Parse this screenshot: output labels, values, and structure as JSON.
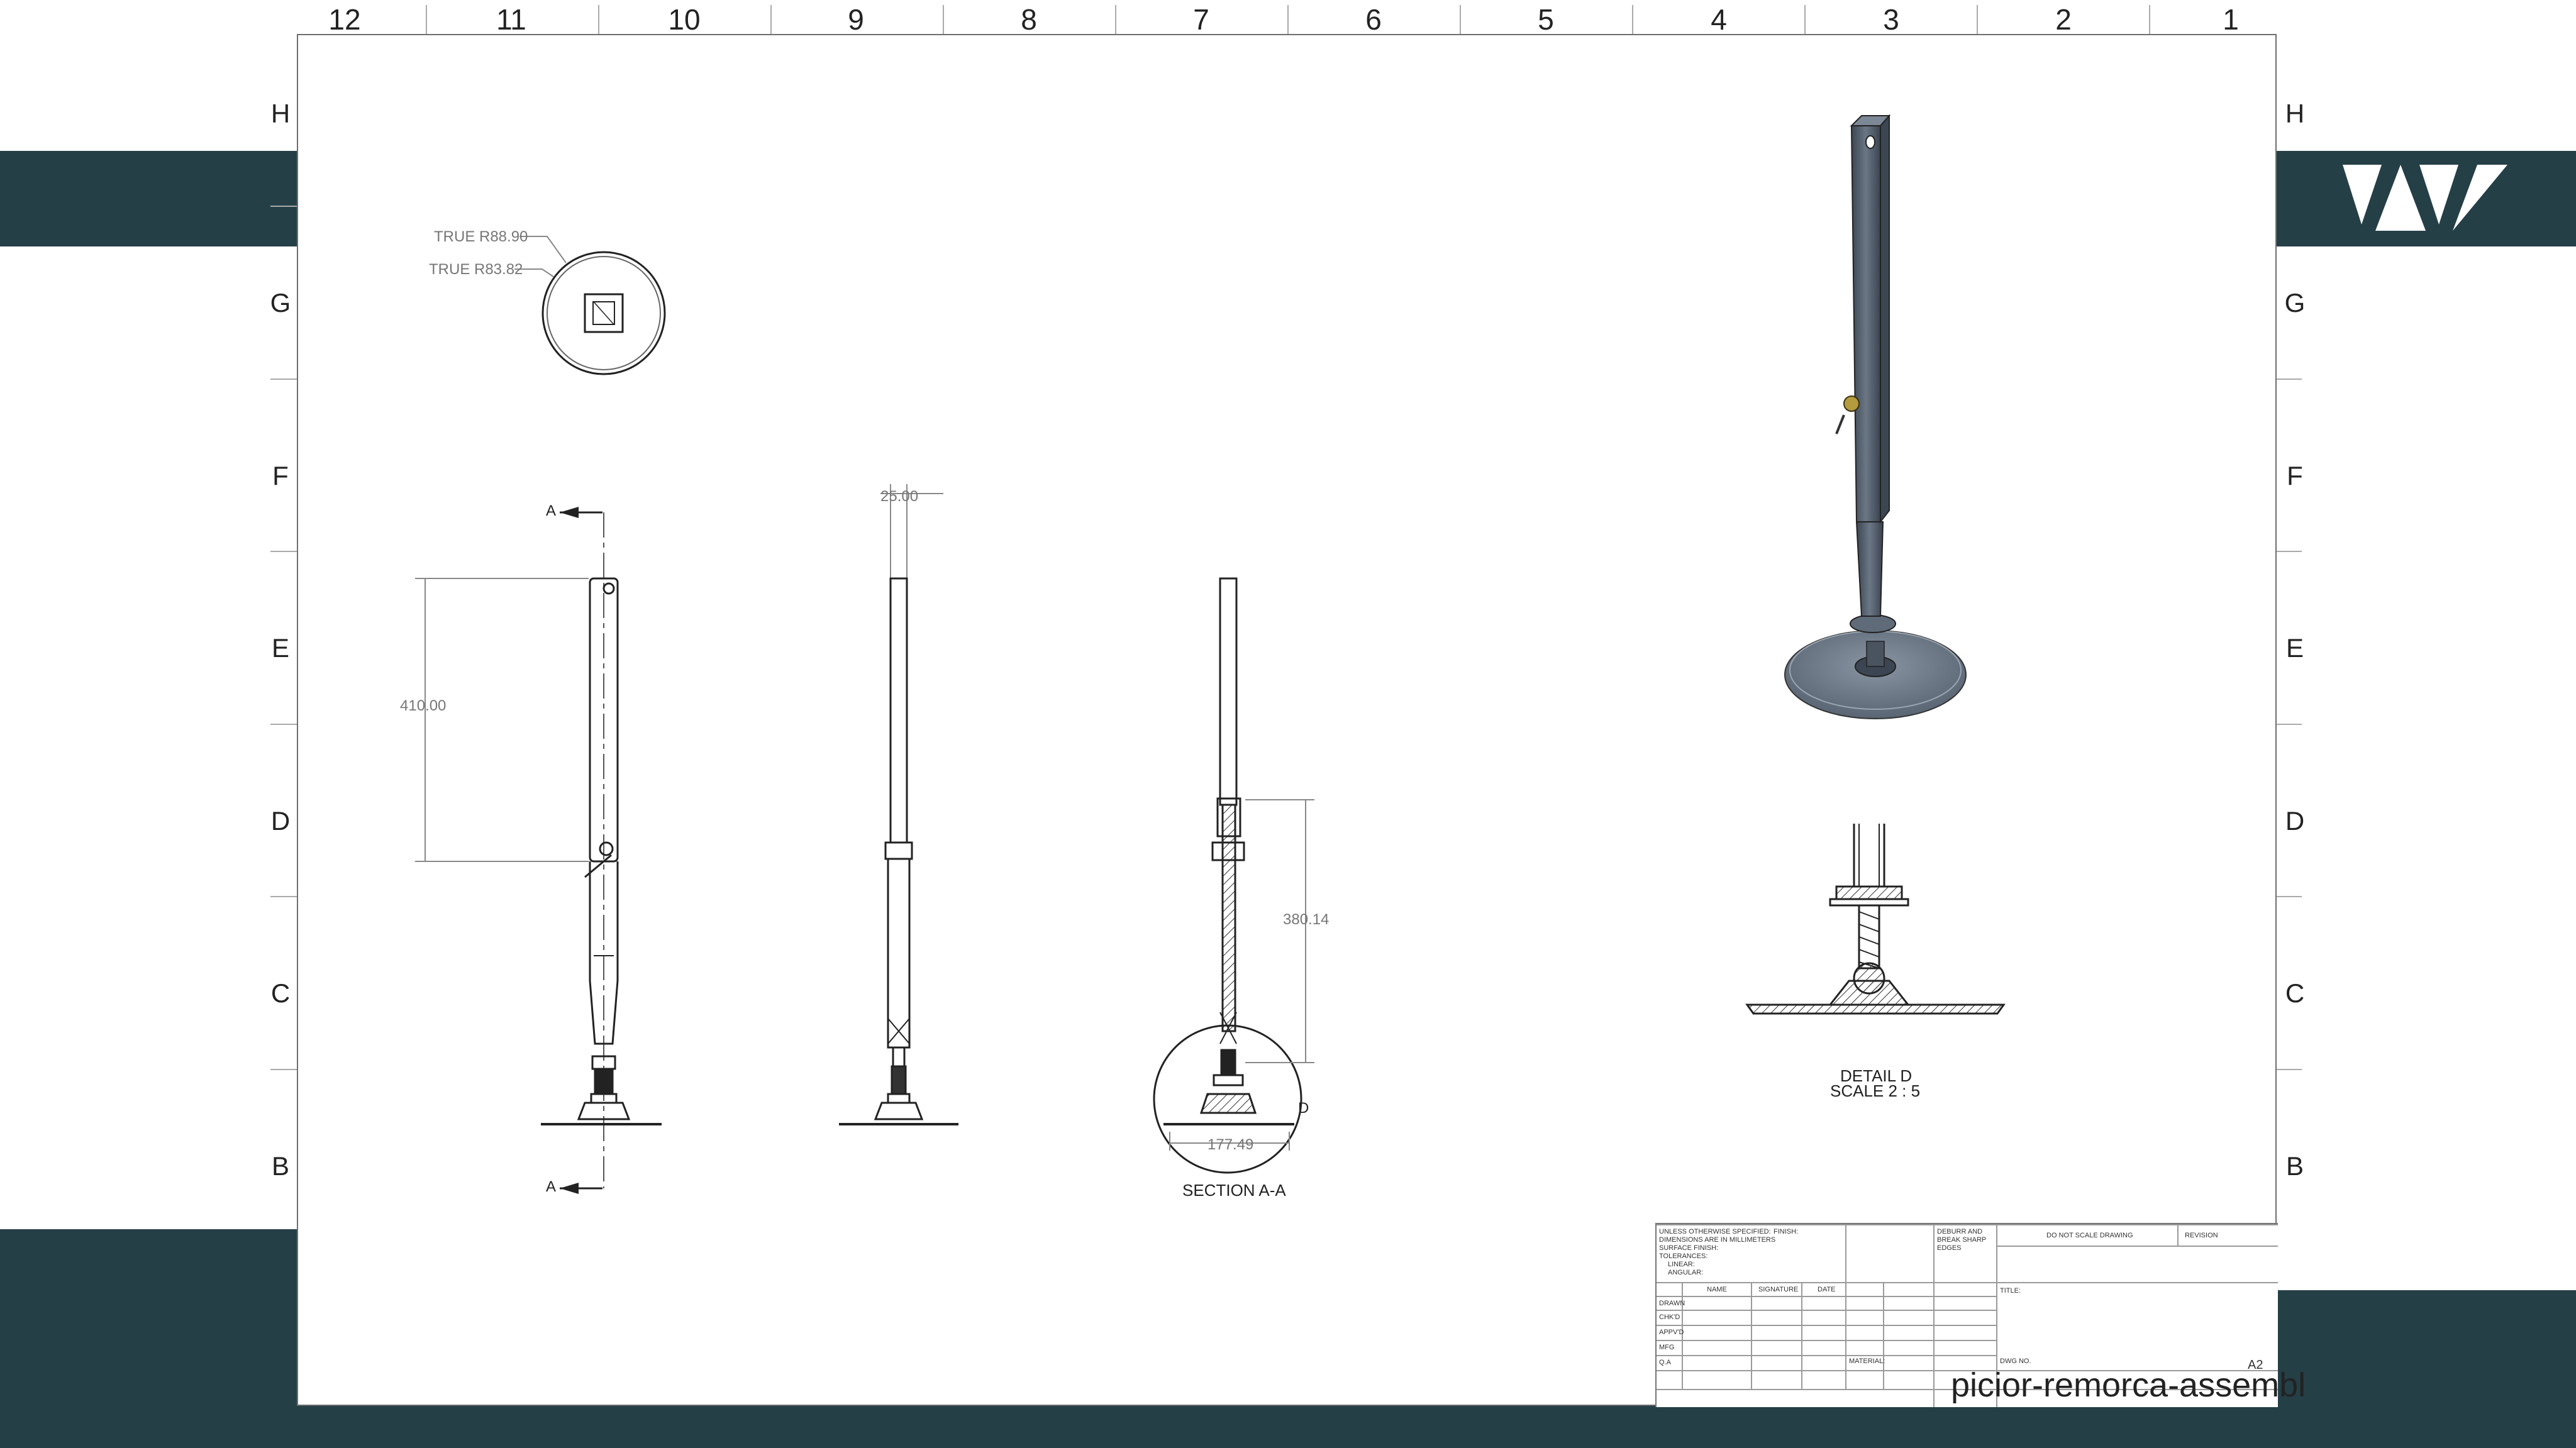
{
  "columns": [
    "12",
    "11",
    "10",
    "9",
    "8",
    "7",
    "6",
    "5",
    "4",
    "3",
    "2",
    "1"
  ],
  "rows": [
    "H",
    "G",
    "F",
    "E",
    "D",
    "C",
    "B"
  ],
  "top_view": {
    "outer_radius": "TRUE R88.90",
    "inner_radius": "TRUE R83.82"
  },
  "front_view": {
    "section_marker": "A",
    "height_dim": "410.00"
  },
  "side_view": {
    "width_dim": "25.00"
  },
  "section_view": {
    "height_dim": "380.14",
    "base_dim": "177.49",
    "detail_marker": "D",
    "caption": "SECTION A-A"
  },
  "detail_view": {
    "caption": "DETAIL D",
    "scale": "SCALE 2 : 5"
  },
  "title_block": {
    "tolerance_note": [
      "UNLESS OTHERWISE SPECIFIED:",
      "DIMENSIONS ARE IN MILLIMETERS",
      "SURFACE FINISH:",
      "TOLERANCES:",
      "LINEAR:",
      "ANGULAR:"
    ],
    "finish": "FINISH:",
    "deburr": [
      "DEBURR AND",
      "BREAK SHARP",
      "EDGES"
    ],
    "do_not_scale": "DO NOT SCALE DRAWING",
    "revision": "REVISION",
    "headers": [
      "NAME",
      "SIGNATURE",
      "DATE"
    ],
    "roles": [
      "DRAWN",
      "CHK'D",
      "APPV'D",
      "MFG",
      "Q.A"
    ],
    "title_label": "TITLE:",
    "material": "MATERIAL:",
    "dwg_no": "DWG NO.",
    "size": "A2",
    "drawing_name": "picior-remorca-assembl"
  },
  "colors": {
    "band": "#253f47",
    "line": "#222222",
    "dim": "#8a8a8a",
    "metal": "#4f5b69"
  }
}
